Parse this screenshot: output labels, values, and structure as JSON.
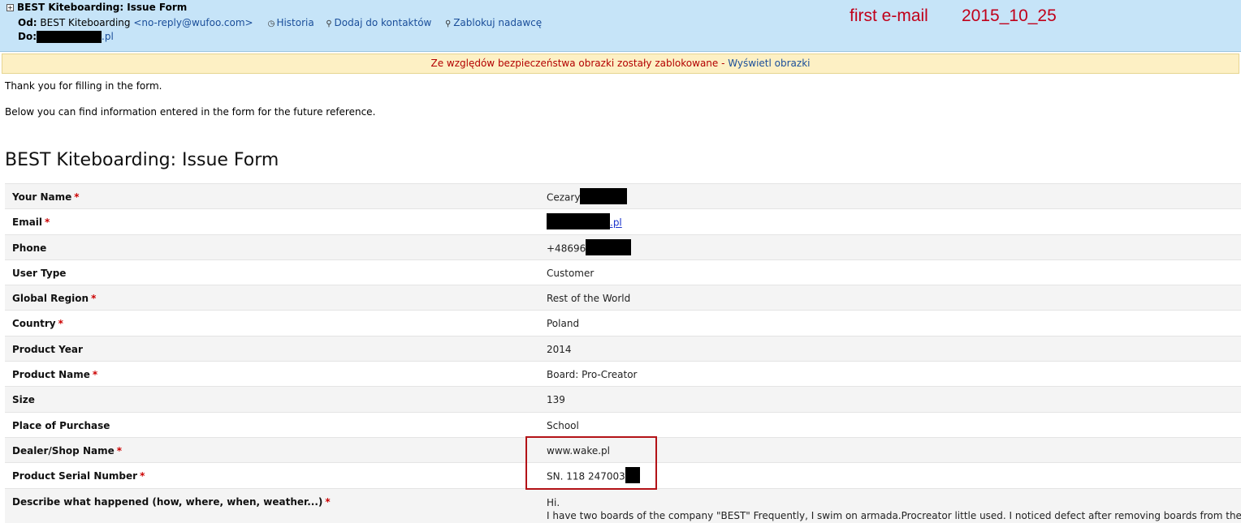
{
  "header": {
    "subject": "BEST Kiteboarding: Issue Form",
    "from_label": "Od:",
    "from_name": "BEST Kiteboarding",
    "from_address": "<no-reply@wufoo.com>",
    "to_label": "Do:",
    "to_suffix": ".pl",
    "actions": [
      {
        "label": "Historia",
        "icon": "clock-icon"
      },
      {
        "label": "Dodaj do kontaktów",
        "icon": "person-add-icon"
      },
      {
        "label": "Zablokuj nadawcę",
        "icon": "person-block-icon"
      }
    ],
    "annotation_1": "first e-mail",
    "annotation_2": "2015_10_25"
  },
  "security_bar": {
    "warning": "Ze względów bezpieczeństwa obrazki zostały zablokowane -",
    "link": "Wyświetl obrazki"
  },
  "body": {
    "intro_1": "Thank you for filling in the form.",
    "intro_2": "Below you can find information entered in the form for the future reference.",
    "form_title": "BEST Kiteboarding: Issue Form"
  },
  "form": {
    "rows": [
      {
        "label": "Your Name",
        "value": "Cezary"
      },
      {
        "label": "Email",
        "value": ".pl"
      },
      {
        "label": "Phone",
        "value": "+48696"
      },
      {
        "label": "User Type",
        "value": "Customer"
      },
      {
        "label": "Global Region",
        "value": "Rest of the World"
      },
      {
        "label": "Country",
        "value": "Poland"
      },
      {
        "label": "Product Year",
        "value": "2014"
      },
      {
        "label": "Product Name",
        "value": "Board: Pro-Creator"
      },
      {
        "label": "Size",
        "value": "139"
      },
      {
        "label": "Place of Purchase",
        "value": "School"
      },
      {
        "label": "Dealer/Shop Name",
        "value": "www.wake.pl"
      },
      {
        "label": "Product Serial Number",
        "value": "SN. 118 247003"
      },
      {
        "label": "Describe what happened (how, where, when, weather...)",
        "value": "Hi.",
        "value_2": "I have two boards of the company \"BEST\" Frequently, I swim on armada.Procreator little used. I noticed defect after removing boards from the case."
      }
    ],
    "required_mark": "*"
  },
  "colors": {
    "header_bg": "#c6e4f8",
    "security_bg": "#fdf0c4",
    "annotation": "#c0001a",
    "required": "#cc0000",
    "highlight_box": "#b31217"
  }
}
